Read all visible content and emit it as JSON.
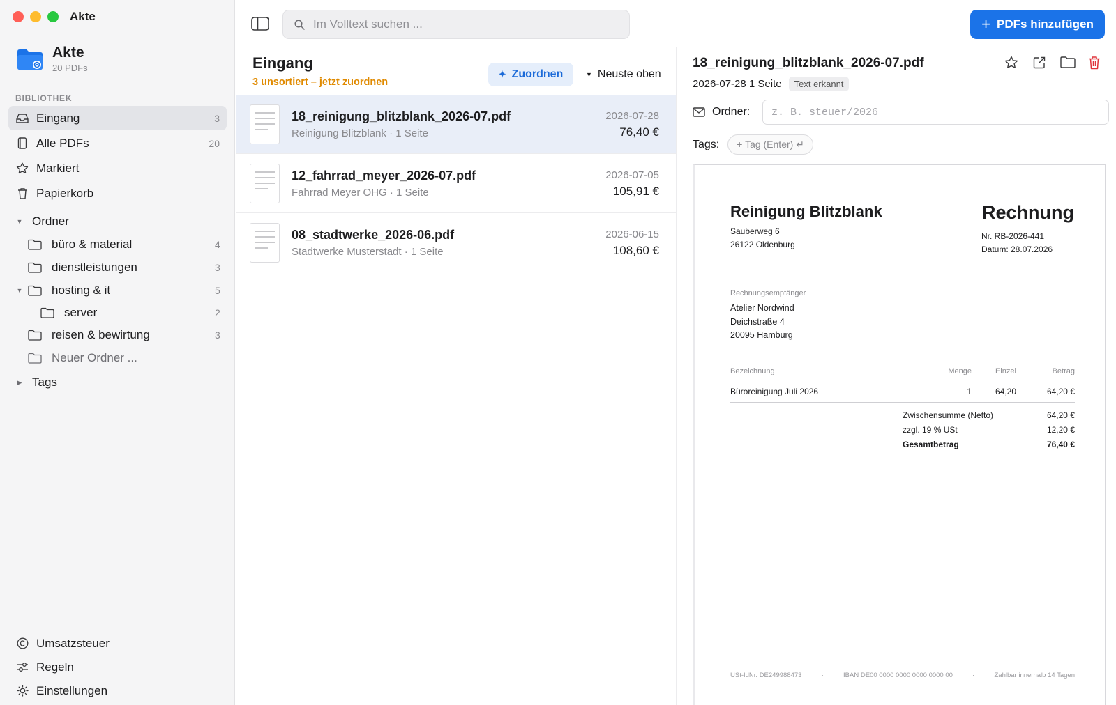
{
  "window": {
    "title": "Akte"
  },
  "app": {
    "name": "Akte",
    "subtitle": "20 PDFs"
  },
  "sidebar": {
    "section_label": "BIBLIOTHEK",
    "items": [
      {
        "label": "Eingang",
        "count": "3",
        "icon": "inbox-icon"
      },
      {
        "label": "Alle PDFs",
        "count": "20",
        "icon": "document-icon"
      },
      {
        "label": "Markiert",
        "count": "",
        "icon": "star-icon"
      },
      {
        "label": "Papierkorb",
        "count": "",
        "icon": "trash-icon"
      }
    ],
    "folders_label": "Ordner",
    "folders": [
      {
        "label": "büro & material",
        "count": "4"
      },
      {
        "label": "dienstleistungen",
        "count": "3"
      },
      {
        "label": "hosting & it",
        "count": "5"
      },
      {
        "label": "server",
        "count": "2"
      },
      {
        "label": "reisen & bewirtung",
        "count": "3"
      }
    ],
    "new_folder": "Neuer Ordner ...",
    "tags_label": "Tags",
    "bottom": [
      {
        "label": "Umsatzsteuer",
        "icon": "copyright-icon"
      },
      {
        "label": "Regeln",
        "icon": "sliders-icon"
      },
      {
        "label": "Einstellungen",
        "icon": "sun-icon"
      }
    ]
  },
  "search": {
    "placeholder": "Im Volltext suchen ..."
  },
  "add_button": {
    "label": "PDFs hinzufügen"
  },
  "list": {
    "title": "Eingang",
    "subtitle": "3 unsortiert – jetzt zuordnen",
    "assign_label": "Zuordnen",
    "sort_label": "Neuste oben",
    "rows": [
      {
        "name": "18_reinigung_blitzblank_2026-07.pdf",
        "meta": "Reinigung Blitzblank · 1 Seite",
        "date": "2026-07-28",
        "amount": "76,40 €"
      },
      {
        "name": "12_fahrrad_meyer_2026-07.pdf",
        "meta": "Fahrrad Meyer OHG · 1 Seite",
        "date": "2026-07-05",
        "amount": "105,91 €"
      },
      {
        "name": "08_stadtwerke_2026-06.pdf",
        "meta": "Stadtwerke Musterstadt · 1 Seite",
        "date": "2026-06-15",
        "amount": "108,60 €"
      }
    ]
  },
  "detail": {
    "title": "18_reinigung_blitzblank_2026-07.pdf",
    "meta": "2026-07-28 1 Seite",
    "badge": "Text erkannt",
    "folder_label": "Ordner:",
    "folder_placeholder": "z. B. steuer/2026",
    "tags_label": "Tags:",
    "tag_chip": "+ Tag (Enter) ↵"
  },
  "invoice": {
    "company": "Reinigung Blitzblank",
    "street": "Sauberweg 6",
    "city": "26122 Oldenburg",
    "doc_type": "Rechnung",
    "number": "Nr. RB-2026-441",
    "date": "Datum: 28.07.2026",
    "recipient_label": "Rechnungsempfänger",
    "recipient_name": "Atelier Nordwind",
    "recipient_street": "Deichstraße 4",
    "recipient_city": "20095 Hamburg",
    "headers": [
      "Bezeichnung",
      "Menge",
      "Einzel",
      "Betrag"
    ],
    "line": [
      "Büroreinigung Juli 2026",
      "1",
      "64,20",
      "64,20 €"
    ],
    "subtotal_label": "Zwischensumme (Netto)",
    "subtotal": "64,20 €",
    "vat_label": "zzgl. 19 % USt",
    "vat": "12,20 €",
    "total_label": "Gesamtbetrag",
    "total": "76,40 €",
    "footer": [
      "USt-IdNr. DE249988473",
      "·",
      "IBAN DE00 0000 0000 0000 0000 00",
      "·",
      "Zahlbar innerhalb 14 Tagen"
    ]
  },
  "colors": {
    "accent": "#1b73e8",
    "warning": "#e08a00",
    "delete": "#e0343a"
  }
}
